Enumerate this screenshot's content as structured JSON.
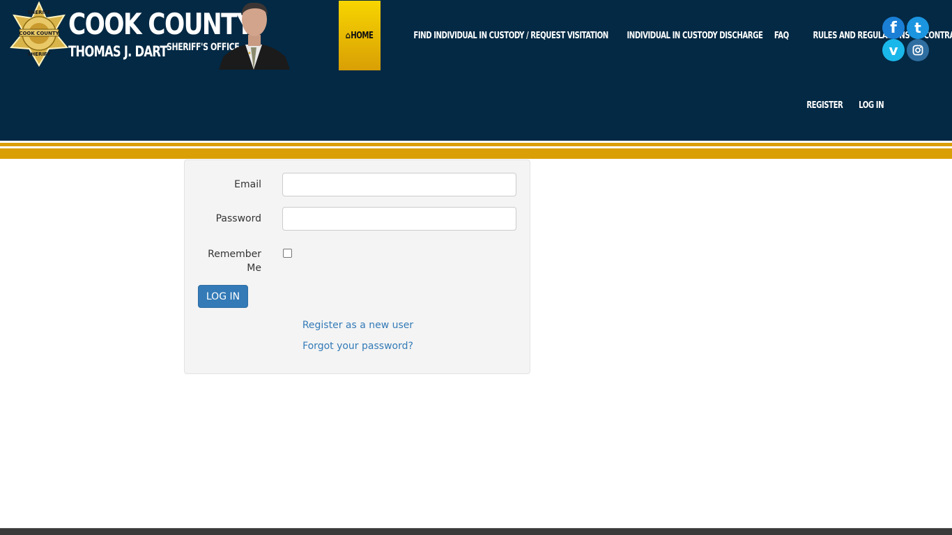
{
  "brand": {
    "title": "COOK COUNTY",
    "subtitle": "THOMAS J. DART",
    "office": "SHERIFF'S OFFICE",
    "badge_top": "SHERIFF",
    "badge_middle": "COOK COUNTY",
    "badge_bottom": "SHERIFF"
  },
  "nav": {
    "home": "HOME",
    "items": [
      "FIND INDIVIDUAL IN CUSTODY / REQUEST VISITATION",
      "INDIVIDUAL IN CUSTODY DISCHARGE",
      "FAQ",
      "RULES AND REGULATIONS",
      "CONTRABAND"
    ],
    "register": "REGISTER",
    "login": "LOG IN"
  },
  "social": [
    "facebook-icon",
    "twitter-icon",
    "vimeo-icon",
    "instagram-icon"
  ],
  "form": {
    "email_label": "Email",
    "email_value": "",
    "password_label": "Password",
    "password_value": "",
    "remember_label_1": "Remember",
    "remember_label_2": "Me",
    "remember_checked": false,
    "submit_label": "LOG IN",
    "register_link": "Register as a new user",
    "forgot_link": "Forgot your password?"
  },
  "colors": {
    "header_bg": "#032944",
    "gold": "#d99f05",
    "active_nav": "#f7d500",
    "primary": "#337ab7"
  }
}
